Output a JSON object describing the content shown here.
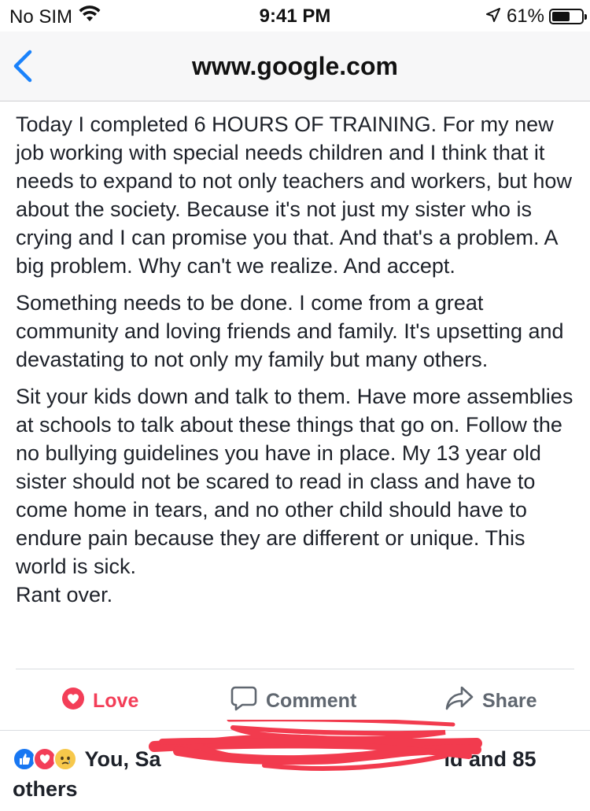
{
  "status_bar": {
    "carrier": "No SIM",
    "time": "9:41 PM",
    "battery_text": "61%",
    "battery_level": 0.61,
    "icons": [
      "wifi-icon",
      "location-arrow-icon",
      "battery-icon"
    ]
  },
  "nav": {
    "title": "www.google.com",
    "back_icon": "chevron-left-icon",
    "accent_color": "#1a82fb"
  },
  "post": {
    "paragraphs": [
      "Today I completed 6 HOURS OF TRAINING. For my new job working with special needs children and I think that it needs to expand to not only teachers and workers, but how about the society. Because it's not just my sister who is crying and I can promise you that. And that's a problem. A big problem. Why can't we realize. And accept.",
      "Something needs to be done. I come from a great community and loving friends and family. It's upsetting and devastating to not only my family but many others.",
      "Sit your kids down and talk to them. Have more assemblies at schools to talk about these things that go on. Follow the no bullying guidelines you have in place. My 13 year old sister should not be scared to read in class and have to come home in tears, and no other child should have to endure pain because they are different or unique. This world is sick."
    ],
    "closing_line": "Rant over."
  },
  "actions": {
    "love_label": "Love",
    "comment_label": "Comment",
    "share_label": "Share",
    "love_color": "#f33e58",
    "muted_color": "#606770"
  },
  "reactions": {
    "text_start": "You, Sa",
    "text_end": "ld and 85 others",
    "icons": [
      "like-icon",
      "love-icon",
      "sad-icon"
    ],
    "redaction_color": "#f23b4e"
  }
}
